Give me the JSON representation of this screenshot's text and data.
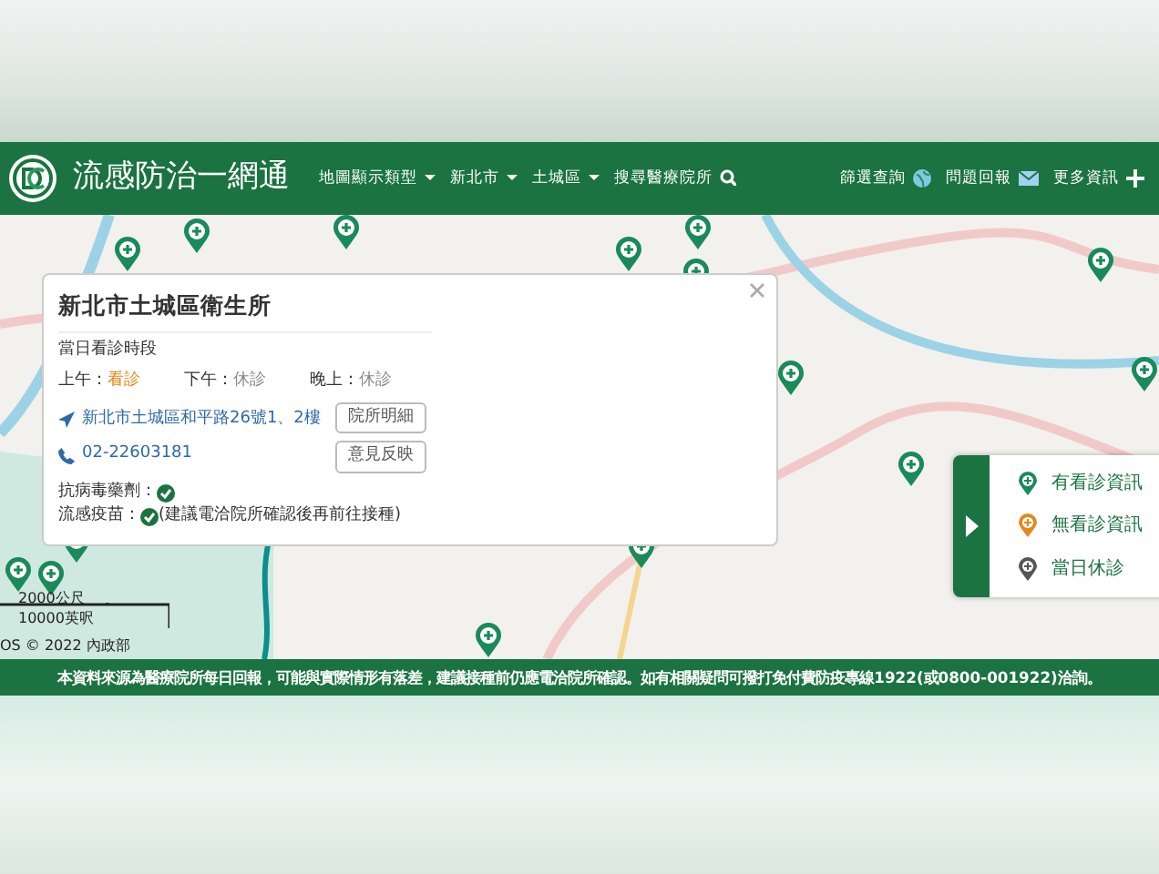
{
  "header": {
    "title": "流感防治一網通",
    "menus": [
      {
        "label": "地圖顯示類型",
        "kind": "dropdown"
      },
      {
        "label": "新北市",
        "kind": "dropdown"
      },
      {
        "label": "土城區",
        "kind": "dropdown"
      },
      {
        "label": "搜尋醫療院所",
        "kind": "search"
      }
    ],
    "right_links": [
      {
        "label": "篩選查詢",
        "kind": "globe"
      },
      {
        "label": "問題回報",
        "kind": "mail"
      },
      {
        "label": "更多資訊",
        "kind": "plus"
      }
    ]
  },
  "popup": {
    "title": "新北市土城區衛生所",
    "schedule_heading": "當日看診時段",
    "sessions": [
      {
        "label": "上午：",
        "status": "看診",
        "open": true
      },
      {
        "label": "下午：",
        "status": "休診",
        "open": false
      },
      {
        "label": "晚上：",
        "status": "休診",
        "open": false
      }
    ],
    "address": "新北市土城區和平路26號1、2樓",
    "phone": "02-22603181",
    "buttons": [
      "院所明細",
      "意見反映"
    ],
    "antiviral": {
      "label": "抗病毒藥劑：",
      "available": true
    },
    "vaccine": {
      "label": "流感疫苗：",
      "available": true,
      "note": "(建議電洽院所確認後再前往接種)"
    }
  },
  "legend": [
    {
      "label": "有看診資訊",
      "color": "#1a8a5a"
    },
    {
      "label": "無看診資訊",
      "color": "#e08a1e"
    },
    {
      "label": "當日休診",
      "color": "#555555"
    }
  ],
  "map": {
    "scale_metric": "2000公尺",
    "scale_imperial": "10000英呎",
    "attribution": "OS © 2022 內政部"
  },
  "footer": "本資料來源為醫療院所每日回報，可能與實際情形有落差，建議接種前仍應電洽院所確認。如有相關疑問可撥打免付費防疫專線1922(或0800-001922)洽詢。"
}
